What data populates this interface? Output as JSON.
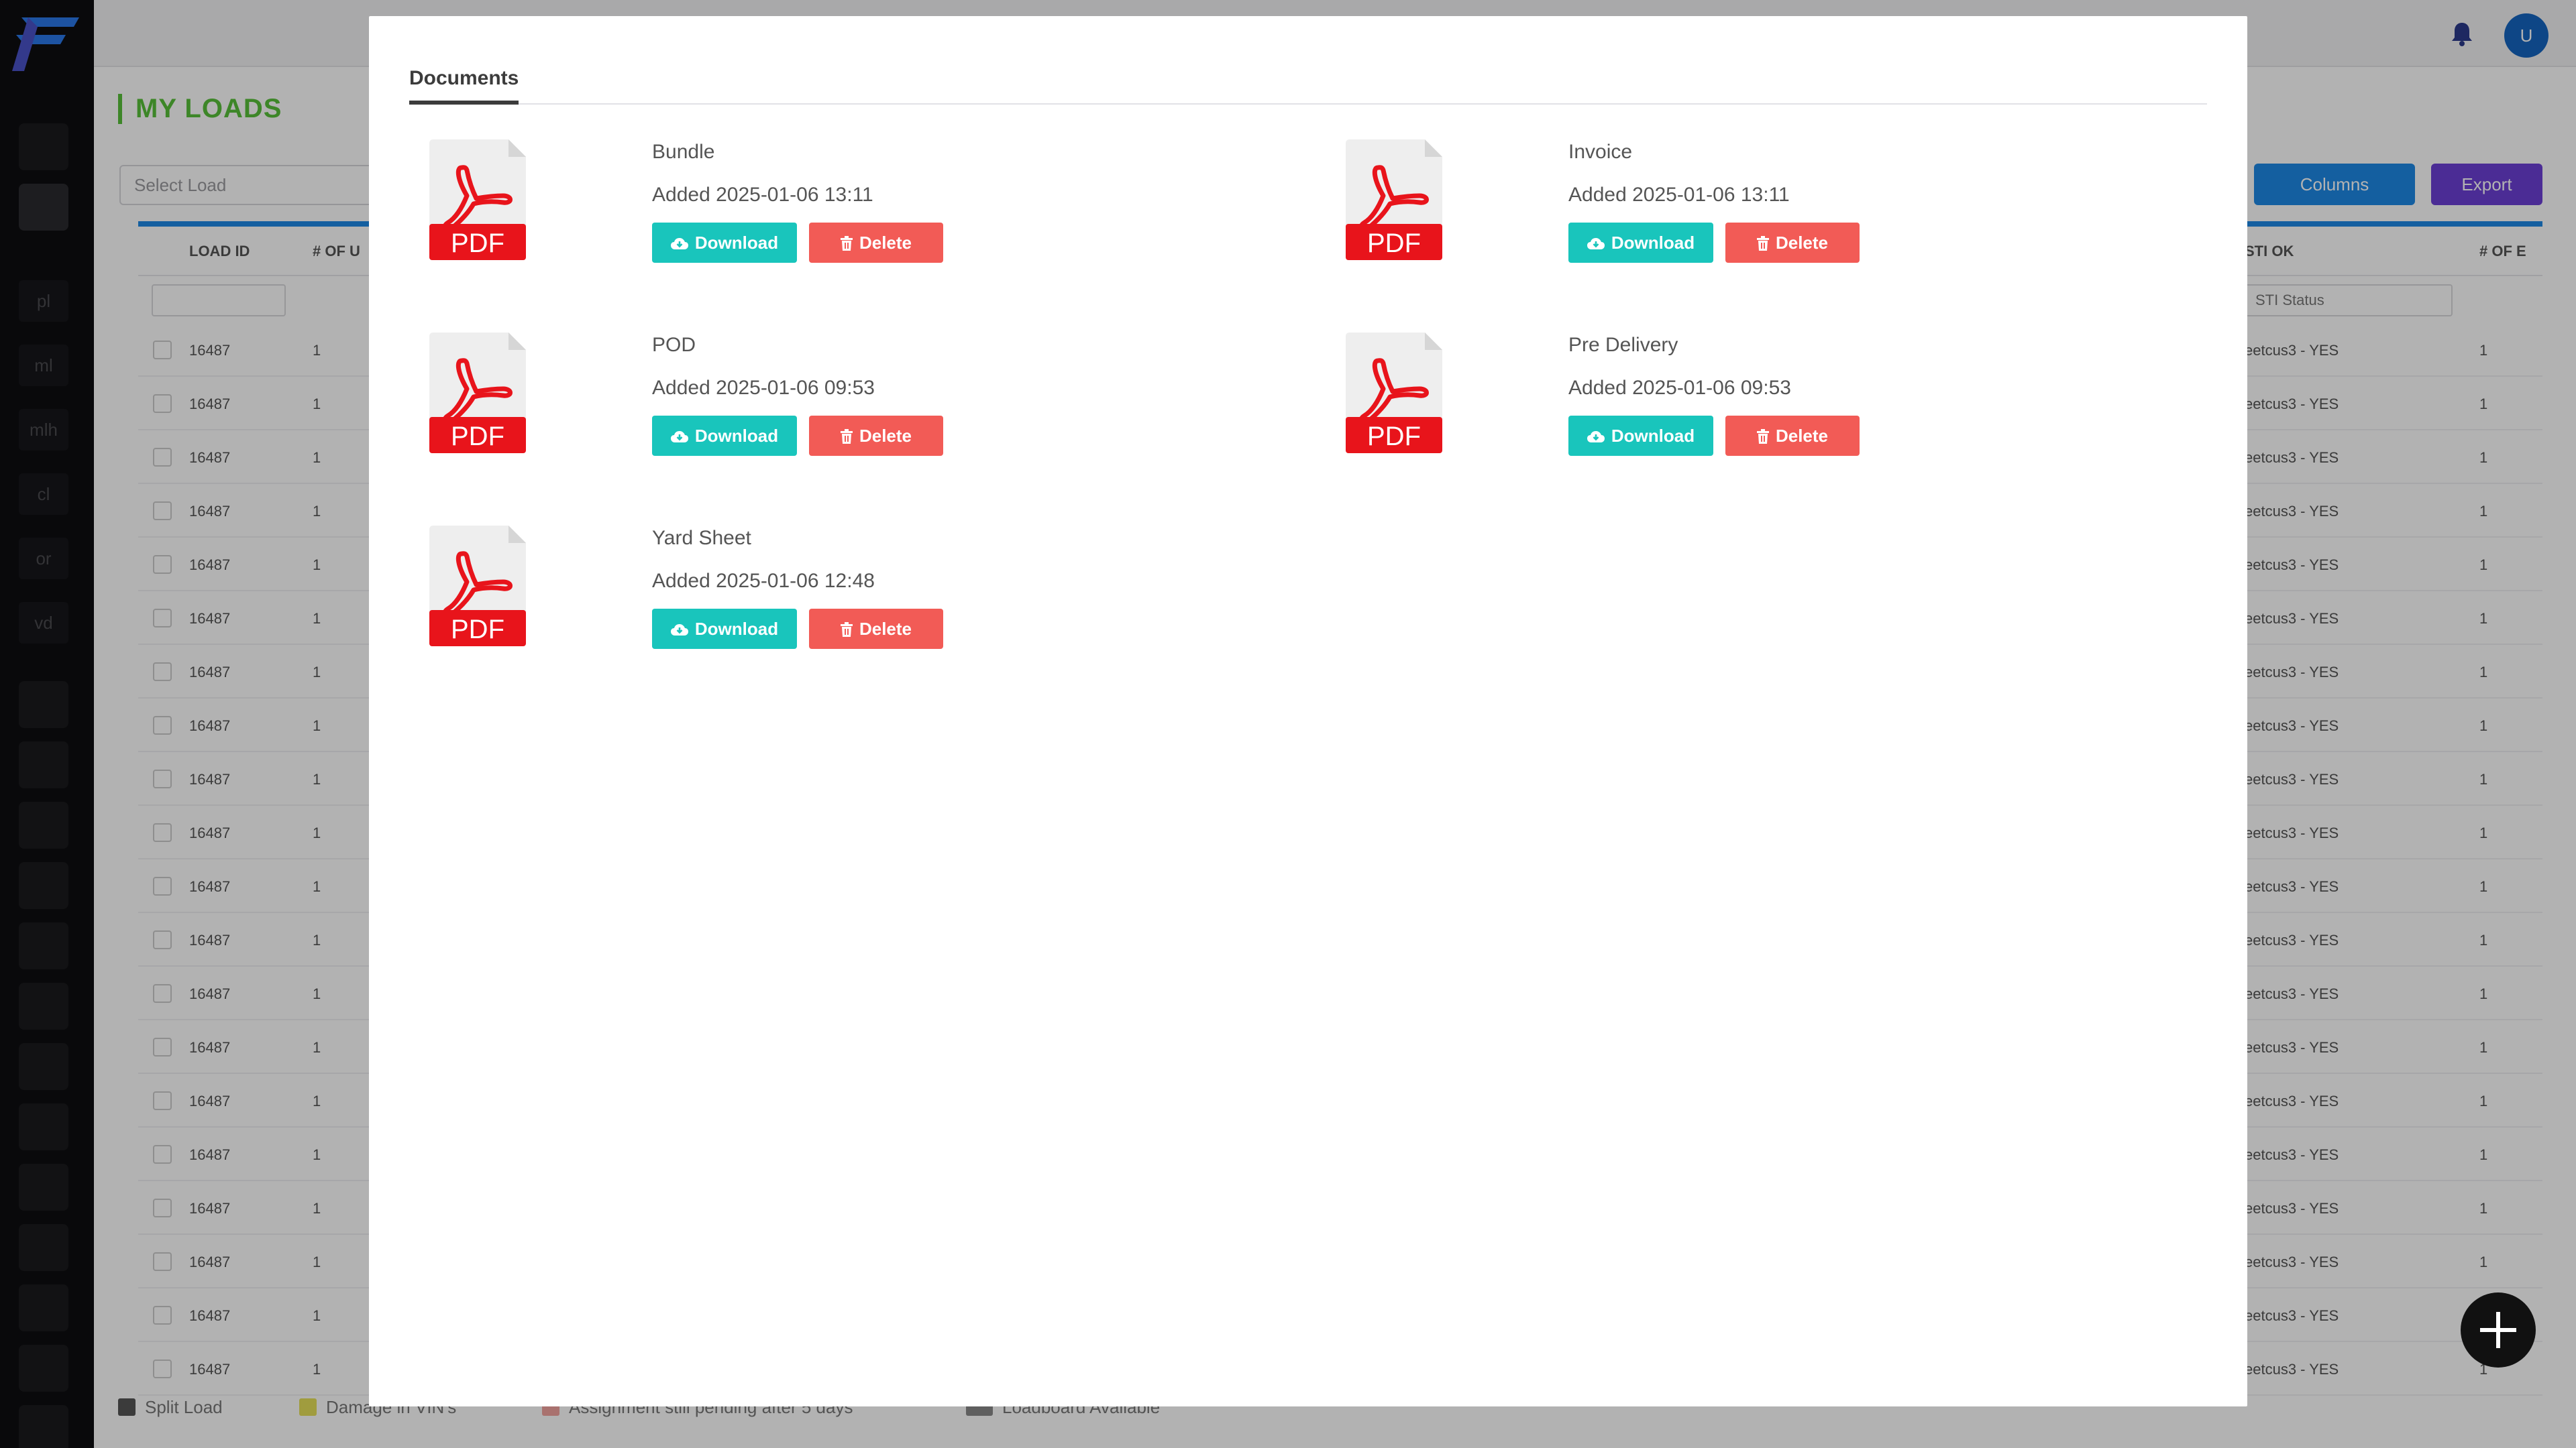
{
  "app": {
    "sidebar_items": [
      "pl",
      "ml",
      "mlh",
      "cl",
      "or",
      "vd"
    ],
    "page_title": "MY LOADS",
    "select_load_placeholder": "Select Load",
    "columns_label": "Columns",
    "export_label": "Export",
    "user_initial": "U",
    "grid": {
      "headers": [
        "LOAD ID",
        "# OF U",
        "STI OK",
        "# OF E"
      ],
      "filter_placeholder": "STI Status",
      "rows": [
        {
          "load_id": "16487",
          "units": "1",
          "sti": "eetcus3 - YES",
          "count": "1"
        },
        {
          "load_id": "16487",
          "units": "1",
          "sti": "eetcus3 - YES",
          "count": "1"
        },
        {
          "load_id": "16487",
          "units": "1",
          "sti": "eetcus3 - YES",
          "count": "1"
        },
        {
          "load_id": "16487",
          "units": "1",
          "sti": "eetcus3 - YES",
          "count": "1"
        },
        {
          "load_id": "16487",
          "units": "1",
          "sti": "eetcus3 - YES",
          "count": "1"
        },
        {
          "load_id": "16487",
          "units": "1",
          "sti": "eetcus3 - YES",
          "count": "1"
        },
        {
          "load_id": "16487",
          "units": "1",
          "sti": "eetcus3 - YES",
          "count": "1"
        },
        {
          "load_id": "16487",
          "units": "1",
          "sti": "eetcus3 - YES",
          "count": "1"
        },
        {
          "load_id": "16487",
          "units": "1",
          "sti": "eetcus3 - YES",
          "count": "1"
        },
        {
          "load_id": "16487",
          "units": "1",
          "sti": "eetcus3 - YES",
          "count": "1"
        },
        {
          "load_id": "16487",
          "units": "1",
          "sti": "eetcus3 - YES",
          "count": "1"
        },
        {
          "load_id": "16487",
          "units": "1",
          "sti": "eetcus3 - YES",
          "count": "1"
        },
        {
          "load_id": "16487",
          "units": "1",
          "sti": "eetcus3 - YES",
          "count": "1"
        },
        {
          "load_id": "16487",
          "units": "1",
          "sti": "eetcus3 - YES",
          "count": "1"
        },
        {
          "load_id": "16487",
          "units": "1",
          "sti": "eetcus3 - YES",
          "count": "1"
        },
        {
          "load_id": "16487",
          "units": "1",
          "sti": "eetcus3 - YES",
          "count": "1"
        },
        {
          "load_id": "16487",
          "units": "1",
          "sti": "eetcus3 - YES",
          "count": "1"
        },
        {
          "load_id": "16487",
          "units": "1",
          "sti": "eetcus3 - YES",
          "count": "1"
        },
        {
          "load_id": "16487",
          "units": "1",
          "sti": "eetcus3 - YES",
          "count": "1"
        },
        {
          "load_id": "16487",
          "units": "1",
          "sti": "eetcus3 - YES",
          "count": "1"
        }
      ]
    },
    "legend": {
      "split_load": "Split Load",
      "damage": "Damage in VIN's",
      "assignment": "Assignment still pending after 5 days",
      "loadboard": "Loadboard Available"
    }
  },
  "modal": {
    "tab_label": "Documents",
    "pdf_badge": "PDF",
    "download_label": "Download",
    "delete_label": "Delete",
    "documents": [
      {
        "title": "Bundle",
        "added": "Added 2025-01-06 13:11"
      },
      {
        "title": "Invoice",
        "added": "Added 2025-01-06 13:11"
      },
      {
        "title": "POD",
        "added": "Added 2025-01-06 09:53"
      },
      {
        "title": "Pre Delivery",
        "added": "Added 2025-01-06 09:53"
      },
      {
        "title": "Yard Sheet",
        "added": "Added 2025-01-06 12:48"
      }
    ]
  },
  "colors": {
    "download": "#19c5bc",
    "delete": "#f25b56",
    "pdf_red": "#e8141b",
    "page_title_green": "#58c03a"
  },
  "icons": {
    "document": "pdf-file-icon",
    "download": "cloud-download-icon",
    "delete": "trash-icon",
    "notifications": "bell-icon",
    "add": "plus-icon"
  }
}
